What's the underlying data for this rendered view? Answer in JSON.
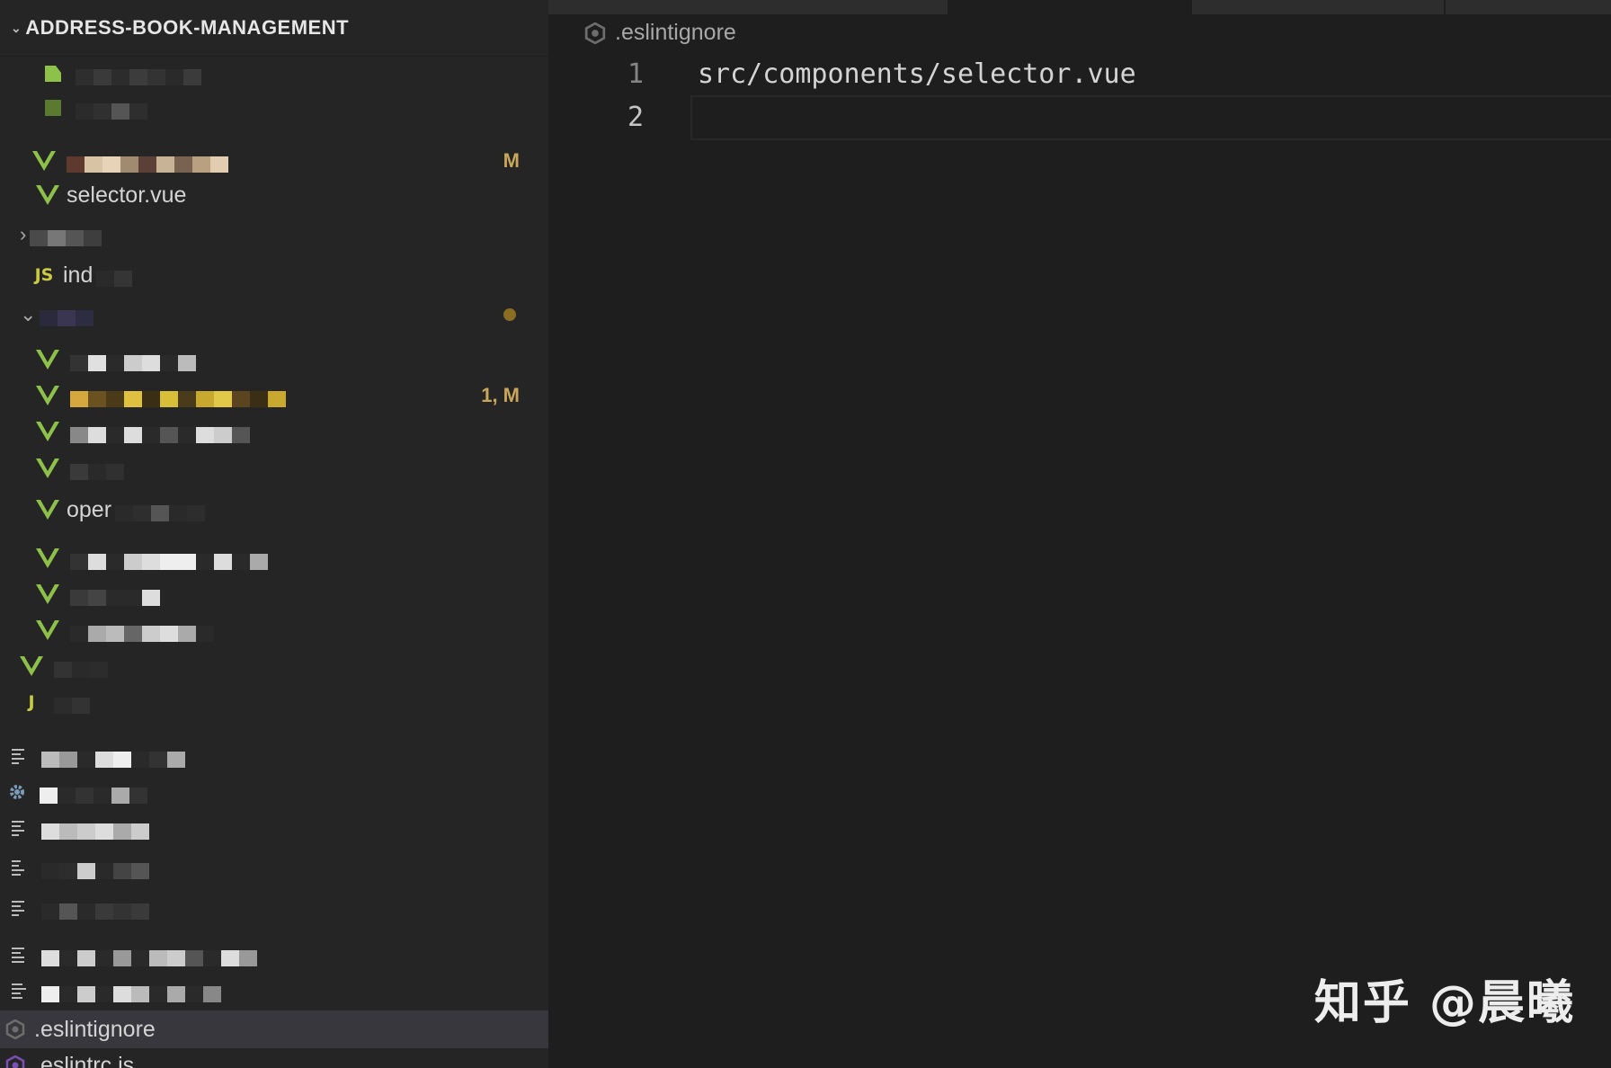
{
  "explorer": {
    "title": "ADDRESS-BOOK-MANAGEMENT",
    "items": [
      {
        "label": "",
        "badge": ""
      },
      {
        "label": "",
        "badge": ""
      },
      {
        "label": "",
        "badge": "M"
      },
      {
        "label": "selector.vue",
        "badge": ""
      },
      {
        "label": "",
        "badge": ""
      },
      {
        "label": "ind",
        "badge": ""
      },
      {
        "label": "",
        "badge": ""
      },
      {
        "label": "",
        "badge": ""
      },
      {
        "label": "",
        "badge": "1, M"
      },
      {
        "label": "",
        "badge": ""
      },
      {
        "label": "",
        "badge": ""
      },
      {
        "label": "oper",
        "badge": ""
      },
      {
        "label": "",
        "badge": ""
      },
      {
        "label": "",
        "badge": ""
      },
      {
        "label": "",
        "badge": ""
      },
      {
        "label": "",
        "badge": ""
      },
      {
        "label": "",
        "badge": ""
      },
      {
        "label": "",
        "badge": ""
      },
      {
        "label": "",
        "badge": ""
      },
      {
        "label": "",
        "badge": ""
      },
      {
        "label": "",
        "badge": ""
      },
      {
        "label": "",
        "badge": ""
      },
      {
        "label": "",
        "badge": ""
      },
      {
        "label": "",
        "badge": ""
      },
      {
        "label": ".eslintignore",
        "badge": ""
      },
      {
        "label": ".eslintrc.js",
        "badge": ""
      }
    ]
  },
  "editor": {
    "breadcrumb": ".eslintignore",
    "lines": [
      {
        "number": "1",
        "text": "src/components/selector.vue"
      },
      {
        "number": "2",
        "text": ""
      }
    ]
  },
  "watermark": "知乎 @晨曦",
  "colors": {
    "modified_badge": "#c9a65a",
    "vue_icon": "#8dc149",
    "js_icon": "#cbcb41",
    "selected_row": "#37373d"
  }
}
